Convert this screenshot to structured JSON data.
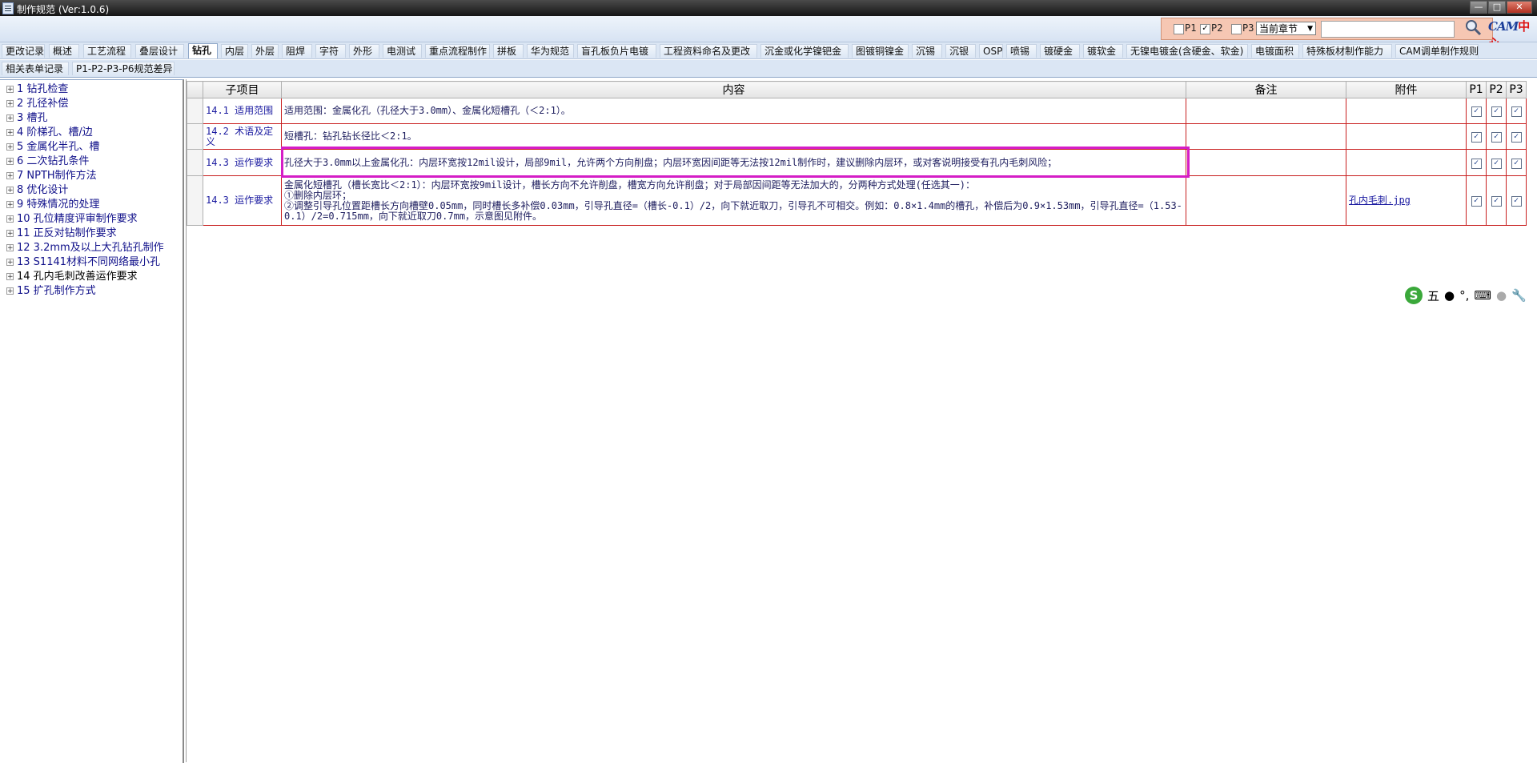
{
  "window": {
    "title": "制作规范 (Ver:1.0.6)",
    "controls": [
      "—",
      "□",
      "✕"
    ]
  },
  "toolbar": {
    "filters": [
      {
        "label": "P1",
        "checked": false
      },
      {
        "label": "P2",
        "checked": true
      },
      {
        "label": "P3",
        "checked": false
      }
    ],
    "scope_select": "当前章节",
    "search_value": "",
    "logo_cam": "CAM",
    "logo_center": "中心"
  },
  "tabs_row1": [
    {
      "label": "更改记录"
    },
    {
      "label": "概述"
    },
    {
      "label": "工艺流程"
    },
    {
      "label": "叠层设计"
    },
    {
      "label": "钻孔",
      "active": true
    },
    {
      "label": "内层"
    },
    {
      "label": "外层"
    },
    {
      "label": "阻焊"
    },
    {
      "label": "字符"
    },
    {
      "label": "外形"
    },
    {
      "label": "电测试"
    },
    {
      "label": "重点流程制作"
    },
    {
      "label": "拼板"
    },
    {
      "label": "华为规范"
    },
    {
      "label": "盲孔板负片电镀"
    },
    {
      "label": "工程资料命名及更改"
    },
    {
      "label": "沉金或化学镍钯金"
    },
    {
      "label": "图镀铜镍金"
    },
    {
      "label": "沉锡"
    },
    {
      "label": "沉银"
    },
    {
      "label": "OSP"
    },
    {
      "label": "喷锡"
    },
    {
      "label": "镀硬金"
    },
    {
      "label": "镀软金"
    },
    {
      "label": "无镍电镀金(含硬金、软金)"
    },
    {
      "label": "电镀面积"
    },
    {
      "label": "特殊板材制作能力"
    },
    {
      "label": "CAM调单制作规则"
    }
  ],
  "tabs_row2": [
    {
      "label": "相关表单记录"
    },
    {
      "label": "P1-P2-P3-P6规范差异"
    }
  ],
  "tree": [
    {
      "label": "1 钻孔检查"
    },
    {
      "label": "2 孔径补偿"
    },
    {
      "label": "3 槽孔"
    },
    {
      "label": "4 阶梯孔、槽/边"
    },
    {
      "label": "5 金属化半孔、槽"
    },
    {
      "label": "6 二次钻孔条件"
    },
    {
      "label": "7 NPTH制作方法"
    },
    {
      "label": "8 优化设计"
    },
    {
      "label": "9 特殊情况的处理"
    },
    {
      "label": "10 孔位精度评审制作要求"
    },
    {
      "label": "11 正反对钻制作要求"
    },
    {
      "label": "12 3.2mm及以上大孔钻孔制作"
    },
    {
      "label": "13 S1141材料不同网络最小孔"
    },
    {
      "label": "14 孔内毛刺改善运作要求",
      "selected": true
    },
    {
      "label": "15 扩孔制作方式"
    }
  ],
  "grid": {
    "headers": {
      "sub": "子项目",
      "content": "内容",
      "note": "备注",
      "attach": "附件",
      "p1": "P1",
      "p2": "P2",
      "p3": "P3"
    },
    "rows": [
      {
        "sub": "14.1 适用范围",
        "content": "适用范围：金属化孔（孔径大于3.0mm）、金属化短槽孔（＜2:1）。",
        "note": "",
        "attach": "",
        "p": [
          true,
          true,
          true
        ]
      },
      {
        "sub": "14.2 术语及定义",
        "content": "短槽孔：钻孔钻长径比＜2:1。",
        "note": "",
        "attach": "",
        "p": [
          true,
          true,
          true
        ]
      },
      {
        "sub": "14.3 运作要求",
        "content": "孔径大于3.0mm以上金属化孔：内层环宽按12mil设计，局部9mil，允许两个方向削盘；内层环宽因间距等无法按12mil制作时，建议删除内层环，或对客说明接受有孔内毛刺风险；",
        "note": "",
        "attach": "",
        "p": [
          true,
          true,
          true
        ]
      },
      {
        "sub": "14.3 运作要求",
        "content_lines": [
          "金属化短槽孔（槽长宽比＜2:1）：内层环宽按9mil设计，槽长方向不允许削盘，槽宽方向允许削盘；对于局部因间距等无法加大的，分两种方式处理(任选其一)：",
          "①删除内层环；",
          "②调整引导孔位置距槽长方向槽壁0.05mm，同时槽长多补偿0.03mm，引导孔直径=（槽长-0.1）/2，向下就近取刀，引导孔不可相交。例如：0.8×1.4mm的槽孔，补偿后为0.9×1.53mm，引导孔直径=（1.53-0.1）/2=0.715mm，向下就近取刀0.7mm，示意图见附件。"
        ],
        "note": "",
        "attach": "孔内毛刺.jpg",
        "p": [
          true,
          true,
          true
        ]
      }
    ]
  },
  "ime": {
    "label": "五",
    "extra": "°,"
  },
  "colors": {
    "highlight": "#d51dc6",
    "row_border": "#c81e1e",
    "tab_bg": "#dbe6f4"
  }
}
